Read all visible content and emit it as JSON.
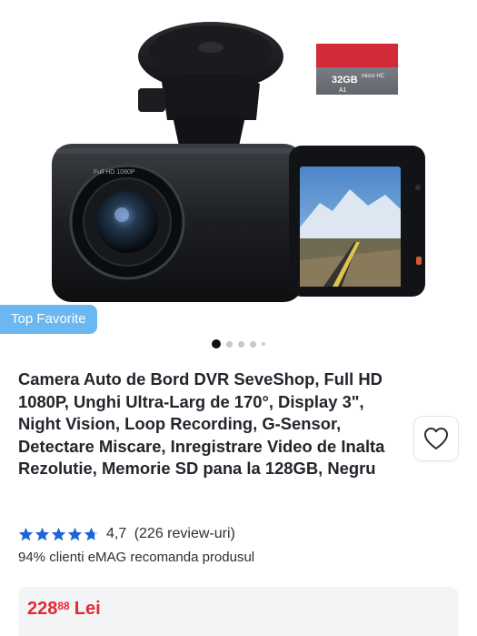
{
  "gallery": {
    "badge_label": "Top Favorite",
    "sd_card_capacity": "32GB",
    "sd_card_brand": "micro HC",
    "sd_card_class": "A1",
    "camera_bezel_text": "Full HD 1080P",
    "dots_total": 5,
    "active_dot": 1
  },
  "product": {
    "title": "Camera Auto de Bord DVR SeveShop, Full HD 1080P, Unghi Ultra-Larg de 170°, Display 3\", Night Vision, Loop Recording, G-Sensor, Detectare Miscare, Inregistrare Video de Inalta Rezolutie, Memorie SD pana la 128GB, Negru",
    "rating_value": "4,7",
    "rating_fill": 0.94,
    "review_count_text": "(226 review-uri)",
    "recommend_text": "94% clienti eMAG recomanda produsul"
  },
  "price": {
    "integer": "228",
    "decimal": "88",
    "currency": "Lei",
    "color": "#e02a38"
  },
  "colors": {
    "badge_bg": "#6ab7f1",
    "star": "#1a66d9"
  },
  "icons": {
    "favorite": "heart-outline-icon",
    "rating": "star-icon"
  }
}
